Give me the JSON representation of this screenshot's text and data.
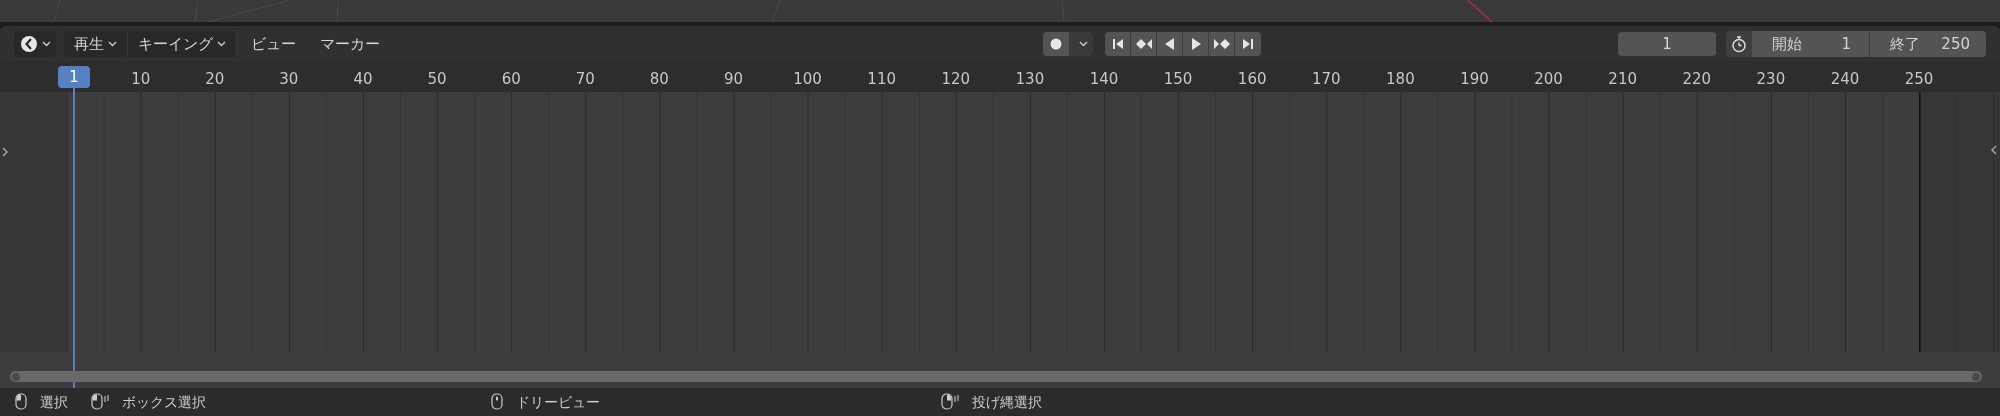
{
  "header": {
    "menus": [
      {
        "label": "再生",
        "kind": "dropdown"
      },
      {
        "label": "キーイング",
        "kind": "dropdown"
      },
      {
        "label": "ビュー",
        "kind": "menu"
      },
      {
        "label": "マーカー",
        "kind": "menu"
      }
    ],
    "auto_keying": {
      "on": false
    },
    "transport": [
      {
        "kind": "jump-start"
      },
      {
        "kind": "prev-key"
      },
      {
        "kind": "play-reverse"
      },
      {
        "kind": "play"
      },
      {
        "kind": "next-key"
      },
      {
        "kind": "jump-end"
      }
    ],
    "current_frame": "1",
    "frame_range": {
      "start_label": "開始",
      "start": "1",
      "end_label": "終了",
      "end": "250"
    }
  },
  "ruler": {
    "playhead": "1",
    "labels": [
      "10",
      "20",
      "30",
      "40",
      "50",
      "60",
      "70",
      "80",
      "90",
      "100",
      "110",
      "120",
      "130",
      "140",
      "150",
      "160",
      "170",
      "180",
      "190",
      "200",
      "210",
      "220",
      "230",
      "240",
      "250"
    ]
  },
  "status_bar": [
    {
      "kind": "left-click",
      "label": "選択"
    },
    {
      "kind": "left-drag",
      "label": "ボックス選択"
    },
    {
      "kind": "middle-click",
      "label": "ドリービュー"
    },
    {
      "kind": "right-drag",
      "label": "投げ縄選択"
    }
  ]
}
